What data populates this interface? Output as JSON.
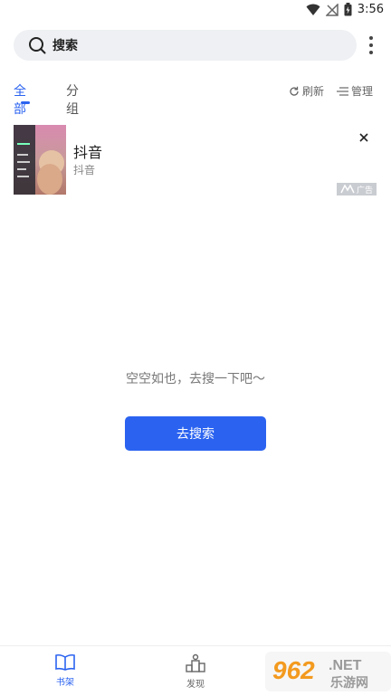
{
  "status_bar": {
    "time": "3:56"
  },
  "search": {
    "label": "搜索"
  },
  "tabs": [
    {
      "label": "全部",
      "active": true
    },
    {
      "label": "分组",
      "active": false
    }
  ],
  "actions": {
    "refresh_label": "刷新",
    "manage_label": "管理"
  },
  "ad": {
    "title": "抖音",
    "subtitle": "抖音",
    "badge": "广告"
  },
  "empty": {
    "message": "空空如也，去搜一下吧～",
    "button_label": "去搜索"
  },
  "bottom_nav": [
    {
      "label": "书架",
      "icon": "book-icon",
      "active": true
    },
    {
      "label": "发现",
      "icon": "discover-icon",
      "active": false
    }
  ],
  "watermark": {
    "number": "962",
    "suffix": ".NET",
    "text": "乐游网"
  },
  "colors": {
    "accent": "#2b63f0",
    "search_bg": "#eef0f3",
    "text_muted": "#777777"
  }
}
